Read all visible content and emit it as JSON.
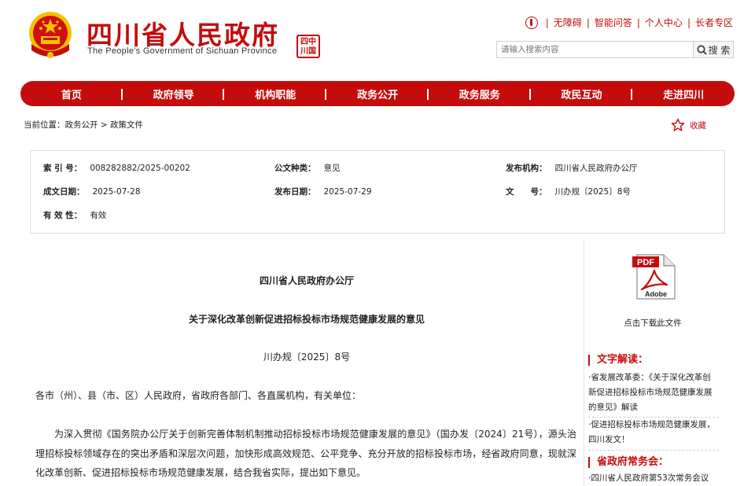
{
  "header": {
    "title": "四川省人民政府",
    "subtitle": "The People's Government of Sichuan Province",
    "seal_text": "四川中国",
    "top_links": [
      "无障碍",
      "智能问答",
      "个人中心",
      "长者专区"
    ],
    "search_placeholder": "请输入搜索内容",
    "search_button": "搜 索"
  },
  "nav": {
    "items": [
      "首页",
      "政府领导",
      "机构职能",
      "政务公开",
      "政务服务",
      "政民互动",
      "走进四川"
    ]
  },
  "breadcrumb": "当前位置：政务公开 > 政策文件",
  "favorite_label": "收藏",
  "info": {
    "index_label": "索 引 号：",
    "index_value": "008282882/2025-00202",
    "type_label": "公文种类：",
    "type_value": "意见",
    "org_label": "发布机构：",
    "org_value": "四川省人民政府办公厅",
    "created_label": "成文日期：",
    "created_value": "2025-07-28",
    "published_label": "发布日期：",
    "published_value": "2025-07-29",
    "docno_label": "文　　号：",
    "docno_value": "川办规〔2025〕8号",
    "valid_label": "有 效 性：",
    "valid_value": "有效"
  },
  "document": {
    "issuer": "四川省人民政府办公厅",
    "title": "关于深化改革创新促进招标投标市场规范健康发展的意见",
    "number": "川办规〔2025〕8号",
    "salutation": "各市（州）、县（市、区）人民政府，省政府各部门、各直属机构，有关单位：",
    "paragraph1": "为深入贯彻《国务院办公厅关于创新完善体制机制推动招标投标市场规范健康发展的意见》（国办发〔2024〕21号），源头治理招标投标领域存在的突出矛盾和深层次问题，加快形成高效规范、公平竞争、充分开放的招标投标市场，经省政府同意，现就深化改革创新、促进招标投标市场规范健康发展，结合我省实际，提出如下意见。"
  },
  "sidebar": {
    "pdf_label": "PDF",
    "pdf_brand": "Adobe",
    "download_caption": "点击下载此文件",
    "interpretation_heading": "文字解读：",
    "interpretation_links": [
      "·省发展改革委：《关于深化改革创新促进招标投标市场规范健康发展的意见》解读",
      "·促进招标投标市场规范健康发展，四川发文！"
    ],
    "meeting_heading": "省政府常务会：",
    "meeting_links": [
      "·四川省人民政府第53次常务会议"
    ]
  },
  "colors": {
    "brand_red": "#c40c0c",
    "gold": "#f2c200"
  }
}
